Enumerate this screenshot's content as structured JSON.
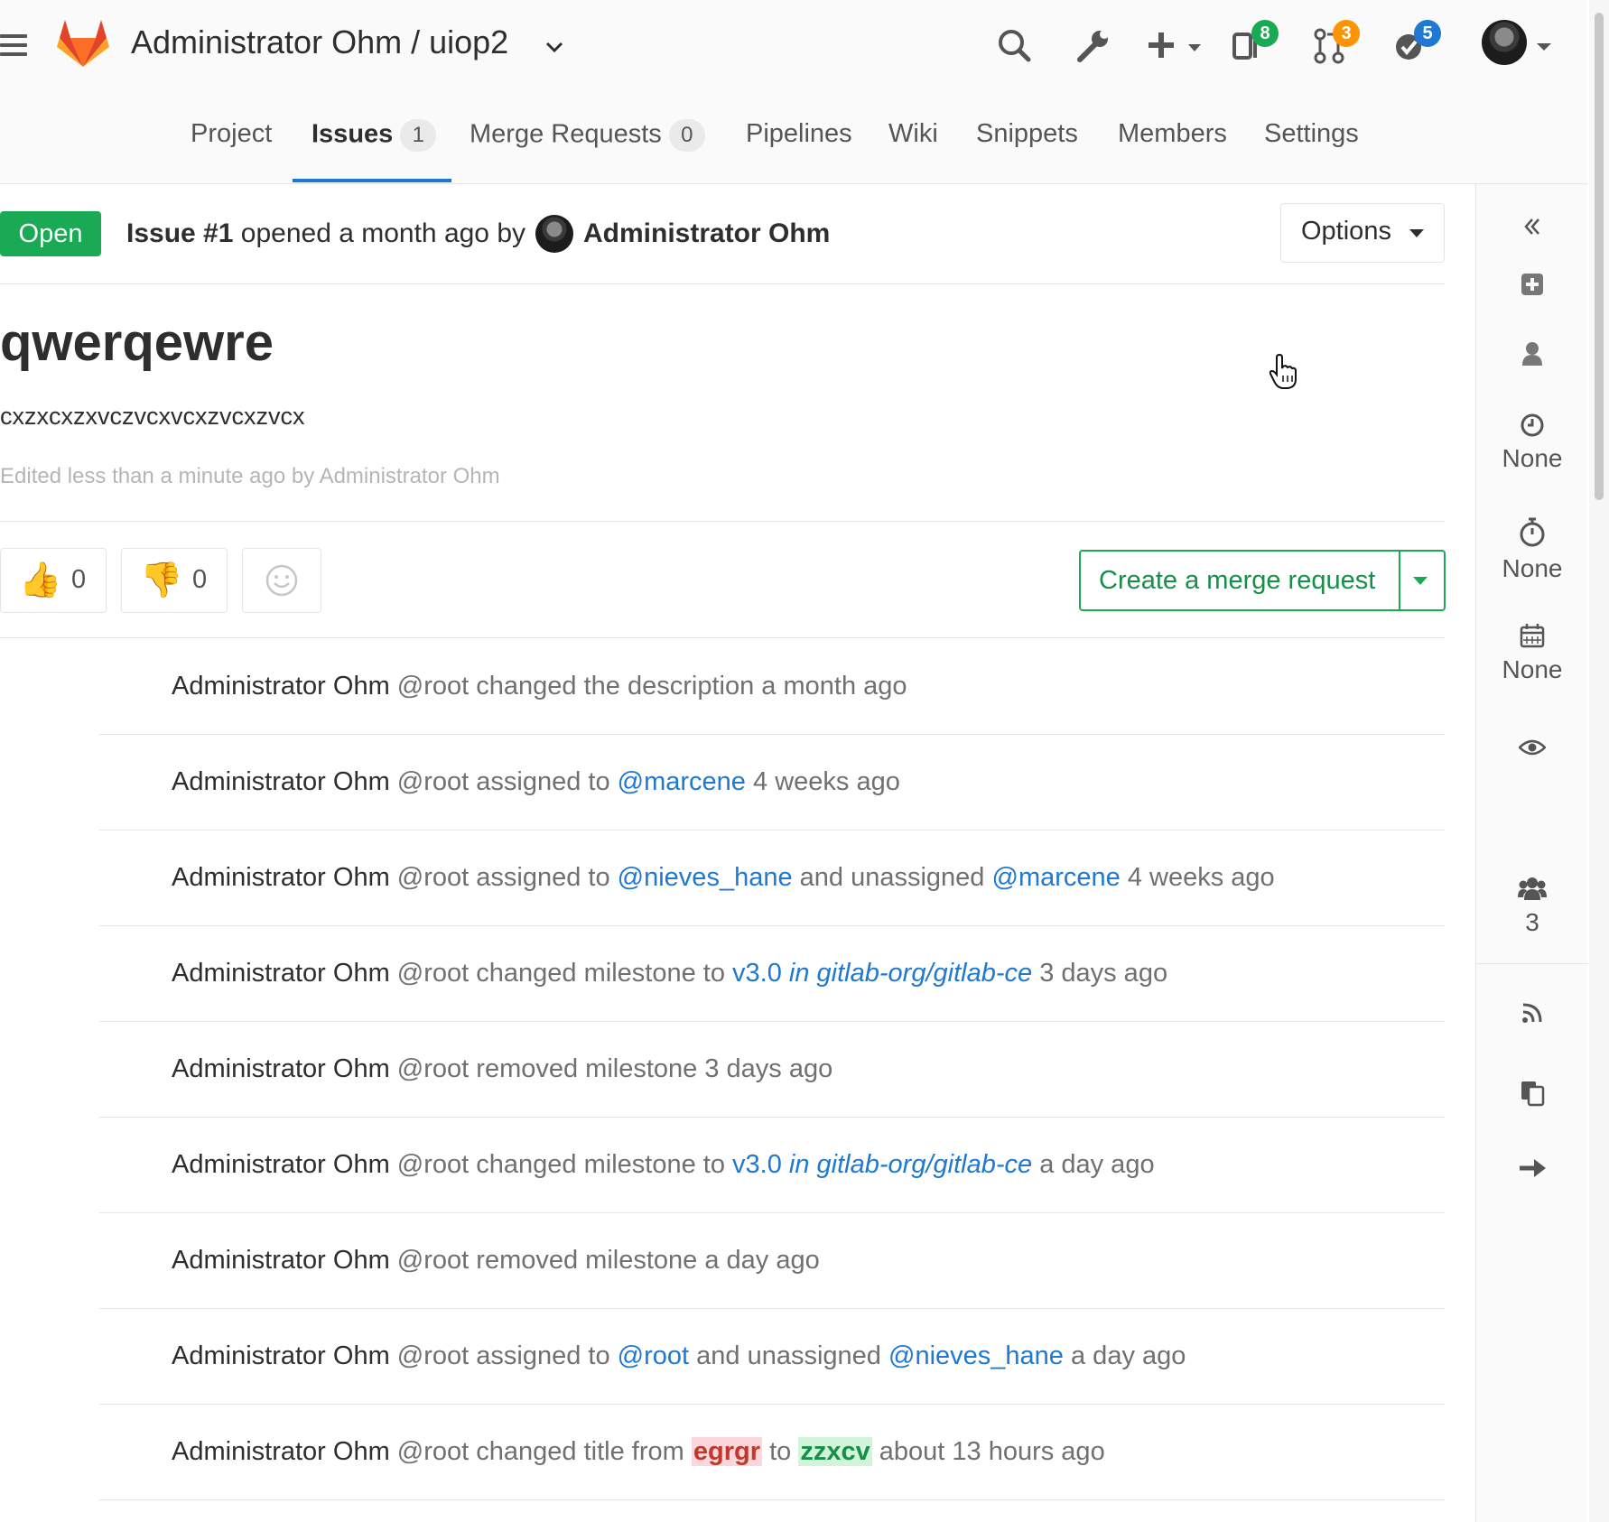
{
  "header": {
    "title": "Administrator Ohm / uiop2",
    "badges": {
      "issues": "8",
      "merge_requests": "3",
      "todos": "5"
    },
    "accent": "#1f78d1"
  },
  "nav": {
    "tabs": [
      {
        "label": "Project"
      },
      {
        "label": "Issues",
        "count": "1",
        "active": true
      },
      {
        "label": "Merge Requests",
        "count": "0"
      },
      {
        "label": "Pipelines"
      },
      {
        "label": "Wiki"
      },
      {
        "label": "Snippets"
      },
      {
        "label": "Members"
      },
      {
        "label": "Settings"
      }
    ]
  },
  "issue": {
    "status": "Open",
    "status_color": "#1aaa55",
    "number": "Issue #1",
    "opened_text": "opened a month ago by",
    "author": "Administrator Ohm",
    "options_label": "Options",
    "title": "qwerqewre",
    "description": "cxzxcxzxvczvcxvcxzvcxzvcx",
    "edited": "Edited less than a minute ago by Administrator Ohm"
  },
  "awards": {
    "thumbs_up": "0",
    "thumbs_down": "0"
  },
  "merge_request_button": "Create a merge request",
  "sidebar": {
    "time_estimate": "None",
    "time_spent": "None",
    "due_date": "None",
    "participants": "3",
    "icons": [
      "collapse-icon",
      "add-todo-icon",
      "assignee-icon",
      "clock-icon",
      "stopwatch-icon",
      "calendar-icon",
      "eye-icon",
      "users-icon",
      "rss-icon",
      "copy-icon",
      "move-icon"
    ]
  },
  "activity": [
    {
      "author": "Administrator Ohm",
      "handle": "@root",
      "pre": "changed the description",
      "time": "a month ago"
    },
    {
      "author": "Administrator Ohm",
      "handle": "@root",
      "pre": "assigned to",
      "link1": "@marcene",
      "time": "4 weeks ago"
    },
    {
      "author": "Administrator Ohm",
      "handle": "@root",
      "pre": "assigned to",
      "link1": "@nieves_hane",
      "mid": "and unassigned",
      "link2": "@marcene",
      "time": "4 weeks ago"
    },
    {
      "author": "Administrator Ohm",
      "handle": "@root",
      "pre": "changed milestone to",
      "link1": "v3.0",
      "link_em": "in gitlab-org/gitlab-ce",
      "time": "3 days ago"
    },
    {
      "author": "Administrator Ohm",
      "handle": "@root",
      "pre": "removed milestone",
      "time": "3 days ago"
    },
    {
      "author": "Administrator Ohm",
      "handle": "@root",
      "pre": "changed milestone to",
      "link1": "v3.0",
      "link_em": "in gitlab-org/gitlab-ce",
      "time": "a day ago"
    },
    {
      "author": "Administrator Ohm",
      "handle": "@root",
      "pre": "removed milestone",
      "time": "a day ago"
    },
    {
      "author": "Administrator Ohm",
      "handle": "@root",
      "pre": "assigned to",
      "link1": "@root",
      "mid": "and unassigned",
      "link2": "@nieves_hane",
      "time": "a day ago"
    },
    {
      "author": "Administrator Ohm",
      "handle": "@root",
      "pre": "changed title from",
      "old": "egrgr",
      "mid": "to",
      "new": "zzxcv",
      "time": "about 13 hours ago"
    }
  ]
}
